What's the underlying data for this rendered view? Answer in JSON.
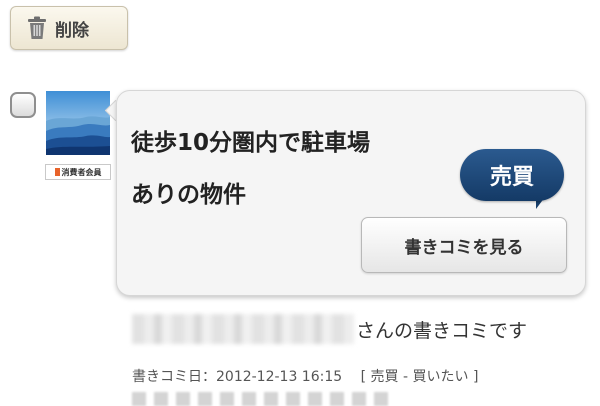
{
  "toolbar": {
    "delete_label": "削除"
  },
  "post": {
    "title_line1": "徒歩10分圏内で駐車場",
    "title_line2": "ありの物件",
    "category": "売買",
    "view_comments_label": "書きコミを見る",
    "member_badge": "消費者会員",
    "author_suffix": "さんの書きコミです",
    "date_label": "書きコミ日：2012-12-13 16:15",
    "category_tag": "[ 売買 - 買いたい ]"
  },
  "icons": {
    "delete": "trash-icon"
  },
  "colors": {
    "category_badge": "#1d4676",
    "card_background": "#f5f5f5",
    "button_background": "#f3eedf"
  }
}
